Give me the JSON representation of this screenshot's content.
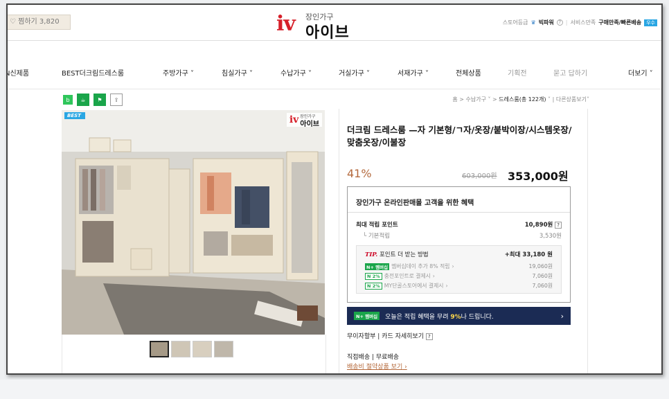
{
  "header": {
    "wishlist_label": "찜하기 3,820",
    "logo_sub": "장인가구",
    "logo_mark": "iv",
    "logo_name": "아이브",
    "store_grade": "스토어등급",
    "grade_name": "빅파워",
    "service": "서비스만족",
    "service_value": "구매만족/빠른배송",
    "badge": "우수"
  },
  "nav": {
    "items": [
      "N신제품",
      "BEST더크림드레스룸",
      "주방가구",
      "침실가구",
      "수납가구",
      "거실가구",
      "서재가구",
      "전체상품",
      "기획전",
      "묻고 답하기",
      "더보기"
    ]
  },
  "breadcrumb": {
    "home": "홈",
    "cat1": "수납가구",
    "cat2": "드레스룸(총 122개)",
    "other": "다른상품보기"
  },
  "image": {
    "best_label": "BEST",
    "watermark_sub": "장인가구",
    "watermark": "아이브"
  },
  "product": {
    "title": "더크림 드레스룸 —자 기본형/ㄱ자/옷장/붙박이장/시스템옷장/맞춤옷장/이불장",
    "discount": "41%",
    "original_price": "603,000원",
    "price": "353,000원"
  },
  "benefit": {
    "heading": "장인가구 온라인판매몰 고객을 위한 혜택",
    "max_point_label": "최대 적립 포인트",
    "max_point_value": "10,890원",
    "base_label": "기본적립",
    "base_value": "3,530원",
    "tip_label": "TIP.",
    "tip_text": "포인트 더 받는 방법",
    "tip_max": "+최대 33,180 원",
    "tips": [
      {
        "badge": "N+ 멤버십",
        "text": "멤버십데이 추가 8% 적립",
        "value": "19,060원"
      },
      {
        "badge": "N 2%",
        "text": "충전포인트로 결제시",
        "value": "7,060원"
      },
      {
        "badge": "N 2%",
        "text": "MY단골스토어에서 결제시",
        "value": "7,060원"
      }
    ]
  },
  "npay": {
    "badge": "N+ 멤버십",
    "text_pre": "오늘은 적립 혜택을 무려 ",
    "pct": "9%",
    "text_post": "나 드립니다."
  },
  "install": {
    "label": "무이자할부",
    "card": "카드 자세히보기"
  },
  "shipping": {
    "method": "직접배송",
    "fee": "무료배송",
    "link": "배송비 절약상품 보기"
  },
  "colors": {
    "accent": "#b46a3e",
    "logo_red": "#d6202a",
    "npay_bg": "#1b2b54",
    "naver_green": "#1aa54a"
  }
}
